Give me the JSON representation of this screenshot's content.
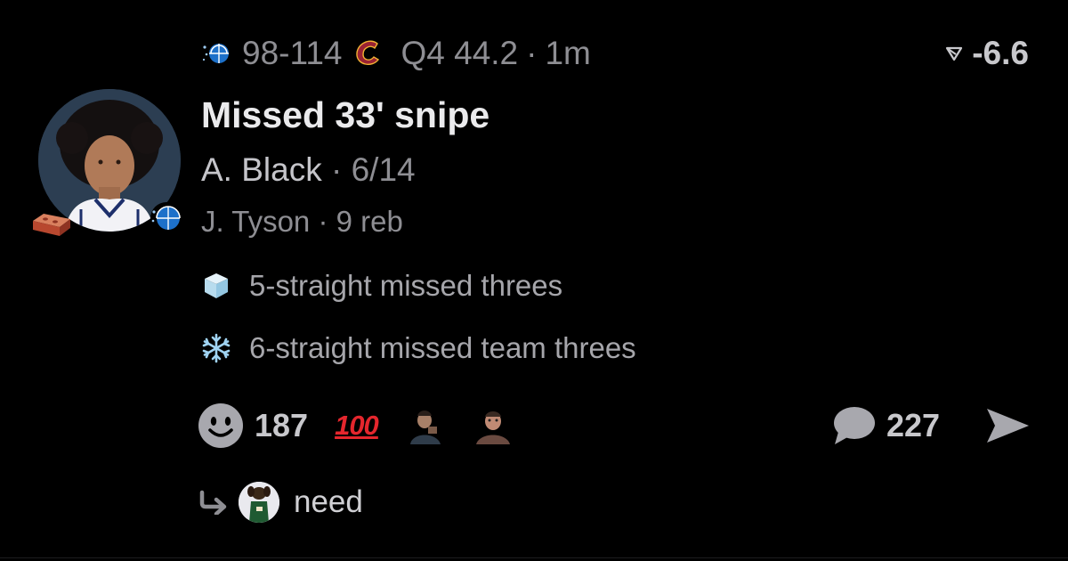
{
  "game": {
    "away_score": "98",
    "dash": "-",
    "home_score": "114",
    "period_clock": "Q4 44.2",
    "dot": "·",
    "age": "1m",
    "away_logo": "orlando-magic-logo",
    "home_logo": "cleveland-cavaliers-logo"
  },
  "delta": {
    "icon": "down-triangle-icon",
    "value": "-6.6"
  },
  "play": {
    "title": "Missed 33' snipe",
    "player": "A. Black",
    "dot": "·",
    "player_stat": "6/14",
    "assist_player": "J. Tyson",
    "assist_stat": "9 reb"
  },
  "streaks": [
    {
      "icon": "ice-cube-icon",
      "text": "5-straight missed threes"
    },
    {
      "icon": "snowflake-icon",
      "text": "6-straight missed team threes"
    }
  ],
  "reactions": {
    "count": "187",
    "hundred": "100"
  },
  "comments": {
    "count": "227"
  },
  "reply": {
    "text": "need"
  },
  "colors": {
    "background": "#000000",
    "muted": "#8e8e93",
    "hundred_red": "#e4262d"
  }
}
